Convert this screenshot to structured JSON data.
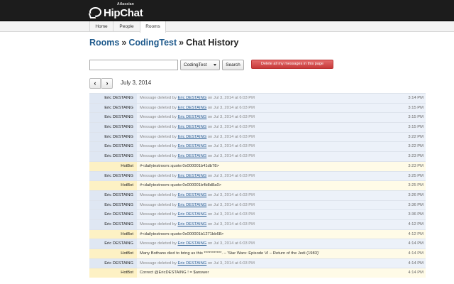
{
  "header": {
    "brand": "HipChat",
    "brand_parent": "Atlassian"
  },
  "nav": {
    "tabs": [
      {
        "label": "Home",
        "active": false
      },
      {
        "label": "People",
        "active": false
      },
      {
        "label": "Rooms",
        "active": true
      }
    ]
  },
  "breadcrumb": {
    "rooms": "Rooms",
    "sep1": "»",
    "room": "CodingTest",
    "sep2": "»",
    "current": "Chat History"
  },
  "toolbar": {
    "search_value": "",
    "room_select": "CodingTest",
    "search_label": "Search",
    "delete_label": "Delete all my messages in this page"
  },
  "date_nav": {
    "prev_glyph": "‹",
    "next_glyph": "›",
    "date": "July 3, 2014"
  },
  "messages": [
    {
      "kind": "user",
      "author": "Eric DESTAING",
      "pre": "Message deleted by ",
      "by": "Eric DESTAING",
      "post": " on Jul 3, 2014 at 6:03 PM",
      "time": "3:14 PM"
    },
    {
      "kind": "user",
      "author": "Eric DESTAING",
      "pre": "Message deleted by ",
      "by": "Eric DESTAING",
      "post": " on Jul 3, 2014 at 6:03 PM",
      "time": "3:15 PM"
    },
    {
      "kind": "user",
      "author": "Eric DESTAING",
      "pre": "Message deleted by ",
      "by": "Eric DESTAING",
      "post": " on Jul 3, 2014 at 6:03 PM",
      "time": "3:15 PM"
    },
    {
      "kind": "user",
      "author": "Eric DESTAING",
      "pre": "Message deleted by ",
      "by": "Eric DESTAING",
      "post": " on Jul 3, 2014 at 6:03 PM",
      "time": "3:15 PM"
    },
    {
      "kind": "user",
      "author": "Eric DESTAING",
      "pre": "Message deleted by ",
      "by": "Eric DESTAING",
      "post": " on Jul 3, 2014 at 6:03 PM",
      "time": "3:22 PM"
    },
    {
      "kind": "user",
      "author": "Eric DESTAING",
      "pre": "Message deleted by ",
      "by": "Eric DESTAING",
      "post": " on Jul 3, 2014 at 6:03 PM",
      "time": "3:22 PM"
    },
    {
      "kind": "user",
      "author": "Eric DESTAING",
      "pre": "Message deleted by ",
      "by": "Eric DESTAING",
      "post": " on Jul 3, 2014 at 6:03 PM",
      "time": "3:23 PM"
    },
    {
      "kind": "bot",
      "author": "HotBot",
      "text": "#<dailytestroom::quote:0x000001b41db78>",
      "time": "3:23 PM"
    },
    {
      "kind": "user",
      "author": "Eric DESTAING",
      "pre": "Message deleted by ",
      "by": "Eric DESTAING",
      "post": " on Jul 3, 2014 at 6:03 PM",
      "time": "3:25 PM"
    },
    {
      "kind": "bot",
      "author": "HotBot",
      "text": "#<dailytestroom::quote:0x000001b4b8d8a0>",
      "time": "3:25 PM"
    },
    {
      "kind": "user",
      "author": "Eric DESTAING",
      "pre": "Message deleted by ",
      "by": "Eric DESTAING",
      "post": " on Jul 3, 2014 at 6:03 PM",
      "time": "3:26 PM"
    },
    {
      "kind": "user",
      "author": "Eric DESTAING",
      "pre": "Message deleted by ",
      "by": "Eric DESTAING",
      "post": " on Jul 3, 2014 at 6:03 PM",
      "time": "3:36 PM"
    },
    {
      "kind": "user",
      "author": "Eric DESTAING",
      "pre": "Message deleted by ",
      "by": "Eric DESTAING",
      "post": " on Jul 3, 2014 at 6:03 PM",
      "time": "3:36 PM"
    },
    {
      "kind": "user",
      "author": "Eric DESTAING",
      "pre": "Message deleted by ",
      "by": "Eric DESTAING",
      "post": " on Jul 3, 2014 at 6:03 PM",
      "time": "4:12 PM"
    },
    {
      "kind": "bot",
      "author": "HotBot",
      "text": "#<dailytestroom::quote:0x000001b1271bb68>",
      "time": "4:12 PM"
    },
    {
      "kind": "user",
      "author": "Eric DESTAING",
      "pre": "Message deleted by ",
      "by": "Eric DESTAING",
      "post": " on Jul 3, 2014 at 6:03 PM",
      "time": "4:14 PM"
    },
    {
      "kind": "bot",
      "author": "HotBot",
      "text": "Many Bothans died to bring us this ***********. – 'Star Wars: Episode VI – Return of the Jedi (1983)'",
      "time": "4:14 PM"
    },
    {
      "kind": "user",
      "author": "Eric DESTAING",
      "pre": "Message deleted by ",
      "by": "Eric DESTAING",
      "post": " on Jul 3, 2014 at 6:03 PM",
      "time": "4:14 PM"
    },
    {
      "kind": "bot",
      "author": "HotBot",
      "text": "Correct @EricDESTAING ! = $answer",
      "time": "4:14 PM"
    }
  ],
  "colors": {
    "topbar": "#1c1c1c",
    "link": "#1f5a8c",
    "user_row": "#ecf1f9",
    "bot_row": "#fffbe7",
    "delete_button": "#c73a3a"
  }
}
